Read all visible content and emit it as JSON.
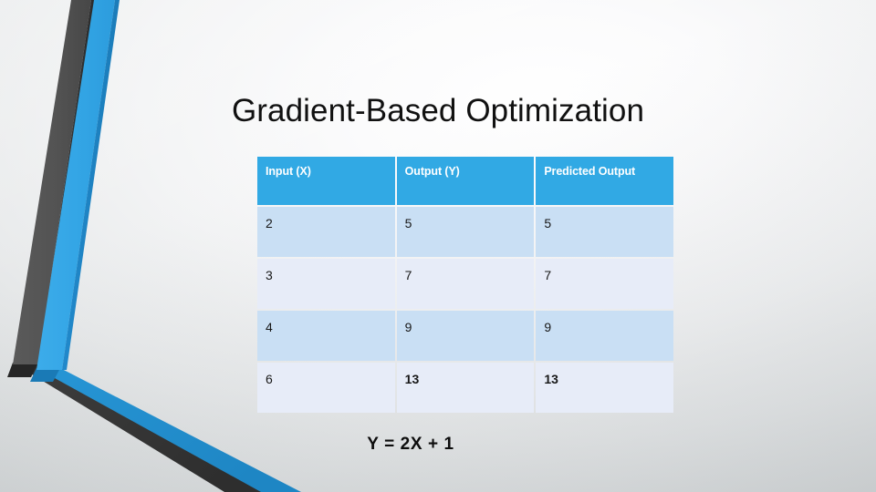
{
  "slide": {
    "title": "Gradient-Based Optimization",
    "formula": "Y = 2X + 1",
    "background_color": "#e2e4e5",
    "accent_color": "#31a9e4",
    "decoration": {
      "name": "bent-chevron-graphic",
      "blue": "#2f9fe0",
      "blue_dark": "#1f86c6",
      "gray": "#4d4d4d",
      "gray_dark": "#333333"
    }
  },
  "table": {
    "name": "gradient-optimization-table",
    "header_background": "#31a9e4",
    "header_text_color": "#ffffff",
    "band_dark": "#c9dff4",
    "band_light": "#e7ecf8",
    "highlight_color": "#a8102e",
    "columns": [
      "Input (X)",
      "Output (Y)",
      "Predicted Output"
    ],
    "rows": [
      {
        "input": "2",
        "output": "5",
        "predicted": "5",
        "highlight": false
      },
      {
        "input": "3",
        "output": "7",
        "predicted": "7",
        "highlight": false
      },
      {
        "input": "4",
        "output": "9",
        "predicted": "9",
        "highlight": false
      },
      {
        "input": "6",
        "output": "13",
        "predicted": "13",
        "highlight": true
      }
    ]
  }
}
